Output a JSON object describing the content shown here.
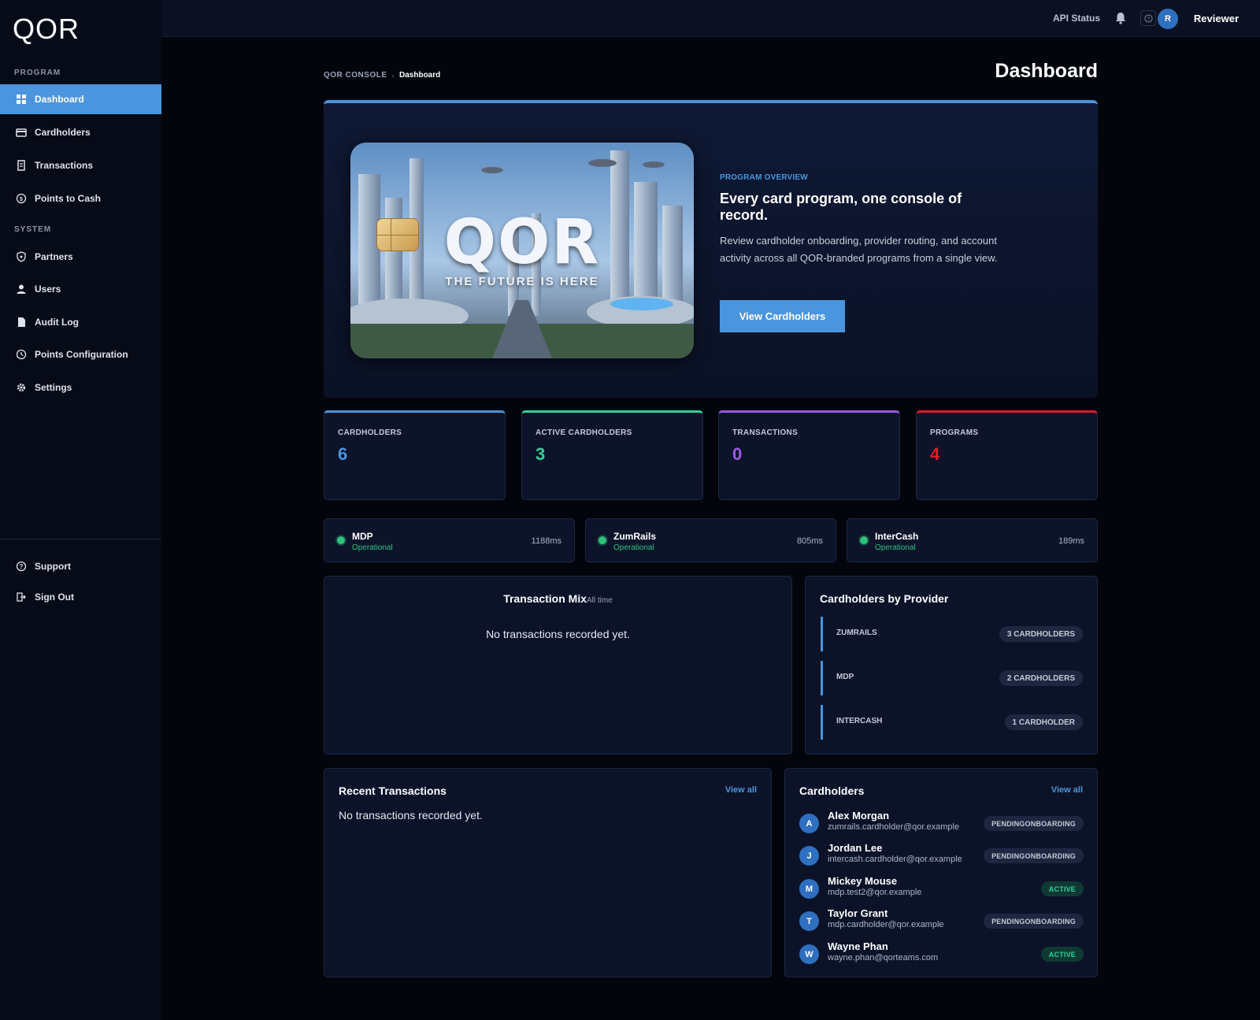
{
  "app": {
    "logo": "QOR"
  },
  "sidebar": {
    "program_label": "PROGRAM",
    "system_label": "SYSTEM",
    "program_items": [
      {
        "label": "Dashboard",
        "icon": "grid-icon",
        "active": true
      },
      {
        "label": "Cardholders",
        "icon": "card-icon"
      },
      {
        "label": "Transactions",
        "icon": "receipt-icon"
      },
      {
        "label": "Points to Cash",
        "icon": "coin-icon"
      }
    ],
    "system_items": [
      {
        "label": "Partners",
        "icon": "shield-icon"
      },
      {
        "label": "Users",
        "icon": "user-icon"
      },
      {
        "label": "Audit Log",
        "icon": "document-icon"
      },
      {
        "label": "Points Configuration",
        "icon": "clock-icon"
      },
      {
        "label": "Settings",
        "icon": "gear-icon"
      }
    ],
    "bottom_items": [
      {
        "label": "Support",
        "icon": "help-circle-icon"
      },
      {
        "label": "Sign Out",
        "icon": "sign-out-icon"
      }
    ]
  },
  "topbar": {
    "api_status": "API Status",
    "user_initial": "R",
    "user_name": "Reviewer"
  },
  "header": {
    "breadcrumb_root": "QOR CONSOLE",
    "breadcrumb_current": "Dashboard",
    "title": "Dashboard"
  },
  "hero": {
    "card_brand": "QOR",
    "card_tagline": "THE FUTURE IS HERE",
    "overview_label": "PROGRAM OVERVIEW",
    "title": "Every card program, one console of record.",
    "description": "Review cardholder onboarding, provider routing, and account activity across all QOR-branded programs from a single view.",
    "button": "View Cardholders"
  },
  "stats": [
    {
      "label": "CARDHOLDERS",
      "value": "6",
      "color": "#4a95dd"
    },
    {
      "label": "ACTIVE CARDHOLDERS",
      "value": "3",
      "color": "#2fd19a"
    },
    {
      "label": "TRANSACTIONS",
      "value": "0",
      "color": "#9b59e8"
    },
    {
      "label": "PROGRAMS",
      "value": "4",
      "color": "#e5192b"
    }
  ],
  "providers": [
    {
      "name": "MDP",
      "status": "Operational",
      "latency": "1188ms"
    },
    {
      "name": "ZumRails",
      "status": "Operational",
      "latency": "805ms"
    },
    {
      "name": "InterCash",
      "status": "Operational",
      "latency": "189ms"
    }
  ],
  "transaction_mix": {
    "title": "Transaction Mix",
    "subtitle": "All time",
    "empty": "No transactions recorded yet."
  },
  "by_provider": {
    "title": "Cardholders by Provider",
    "rows": [
      {
        "name": "ZUMRAILS",
        "count": "3 CARDHOLDERS"
      },
      {
        "name": "MDP",
        "count": "2 CARDHOLDERS"
      },
      {
        "name": "INTERCASH",
        "count": "1 CARDHOLDER"
      }
    ]
  },
  "recent_transactions": {
    "title": "Recent Transactions",
    "view_all": "View all",
    "empty": "No transactions recorded yet."
  },
  "cardholders": {
    "title": "Cardholders",
    "view_all": "View all",
    "rows": [
      {
        "initial": "A",
        "name": "Alex Morgan",
        "email": "zumrails.cardholder@qor.example",
        "status": "PENDINGONBOARDING",
        "kind": "pending"
      },
      {
        "initial": "J",
        "name": "Jordan Lee",
        "email": "intercash.cardholder@qor.example",
        "status": "PENDINGONBOARDING",
        "kind": "pending"
      },
      {
        "initial": "M",
        "name": "Mickey Mouse",
        "email": "mdp.test2@qor.example",
        "status": "ACTIVE",
        "kind": "active"
      },
      {
        "initial": "T",
        "name": "Taylor Grant",
        "email": "mdp.cardholder@qor.example",
        "status": "PENDINGONBOARDING",
        "kind": "pending"
      },
      {
        "initial": "W",
        "name": "Wayne Phan",
        "email": "wayne.phan@qorteams.com",
        "status": "ACTIVE",
        "kind": "active"
      }
    ]
  }
}
